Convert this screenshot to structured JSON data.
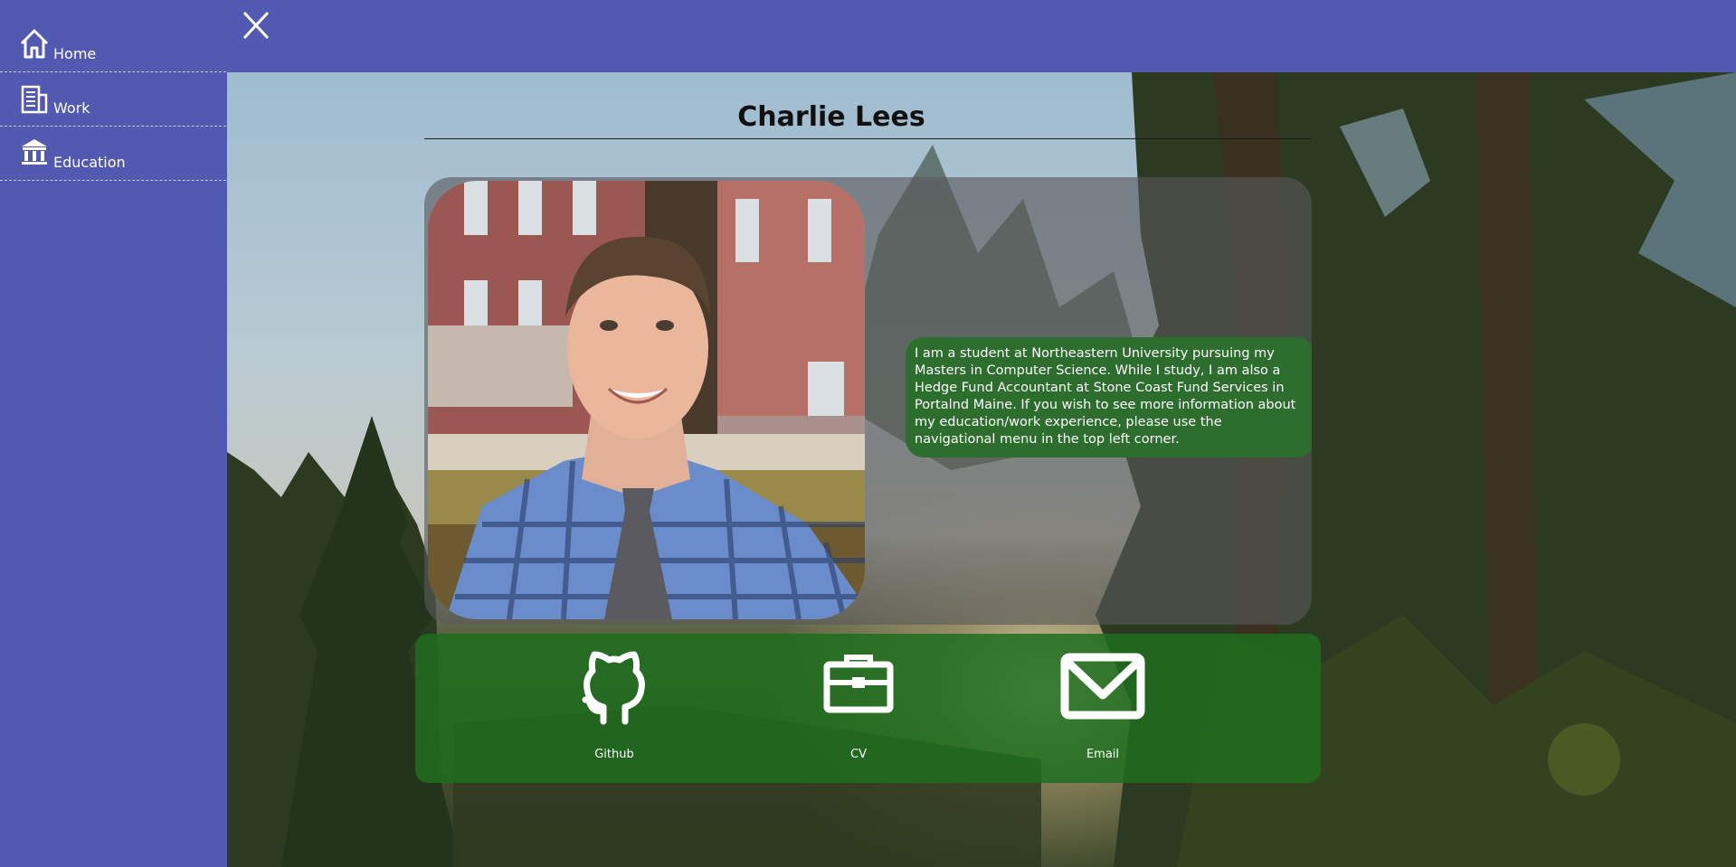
{
  "nav": {
    "close_icon": "close-icon",
    "items": [
      {
        "label": "Home",
        "icon": "home-icon"
      },
      {
        "label": "Work",
        "icon": "building-icon"
      },
      {
        "label": "Education",
        "icon": "bank-icon"
      }
    ]
  },
  "profile": {
    "name": "Charlie Lees",
    "bio": "I am a student at Northeastern University pursuing my Masters in Computer Science. While I study, I am also a Hedge Fund Accountant at Stone Coast Fund Services in Portalnd Maine. If you wish to see more information about my education/work experience, please use the navigational menu in the top left corner."
  },
  "links": [
    {
      "label": "Github",
      "icon": "github-icon"
    },
    {
      "label": "CV",
      "icon": "briefcase-icon"
    },
    {
      "label": "Email",
      "icon": "envelope-icon"
    }
  ],
  "colors": {
    "nav_bg": "#5159b0",
    "bio_bg": "#2d6e2f",
    "links_bg": "#1e6e1e"
  }
}
